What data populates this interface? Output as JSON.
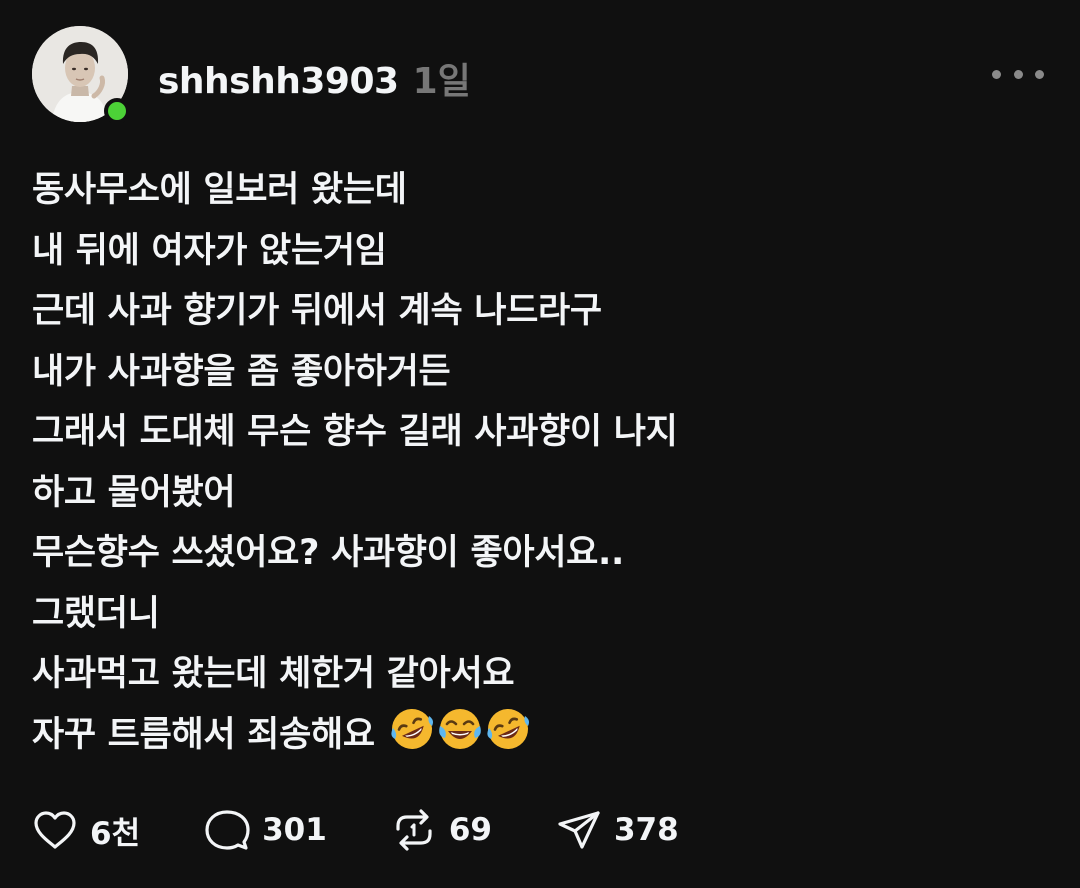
{
  "post": {
    "username": "shhshh3903",
    "timestamp": "1일",
    "lines": [
      "동사무소에 일보러 왔는데",
      "내 뒤에 여자가 앉는거임",
      "근데 사과 향기가 뒤에서 계속 나드라구",
      "내가 사과향을 좀 좋아하거든",
      "그래서 도대체 무슨 향수 길래 사과향이 나지",
      "하고 물어봤어",
      "무슨향수 쓰셨어요? 사과향이 좋아서요..",
      "그랬더니",
      "사과먹고 왔는데 체한거 같아서요",
      "자꾸 트름해서 죄송해요"
    ],
    "emojis": [
      "rolling-on-floor-laughing",
      "face-with-tears-of-joy",
      "rolling-on-floor-laughing"
    ]
  },
  "actions": {
    "like_count": "6천",
    "reply_count": "301",
    "repost_count": "69",
    "share_count": "378"
  },
  "colors": {
    "background": "#101010",
    "text": "#f3f5f7",
    "muted": "#777777",
    "online": "#4cd137"
  },
  "icons": {
    "like": "heart-icon",
    "reply": "comment-bubble-icon",
    "repost": "repost-icon",
    "share": "send-icon",
    "more": "more-dots-icon"
  }
}
